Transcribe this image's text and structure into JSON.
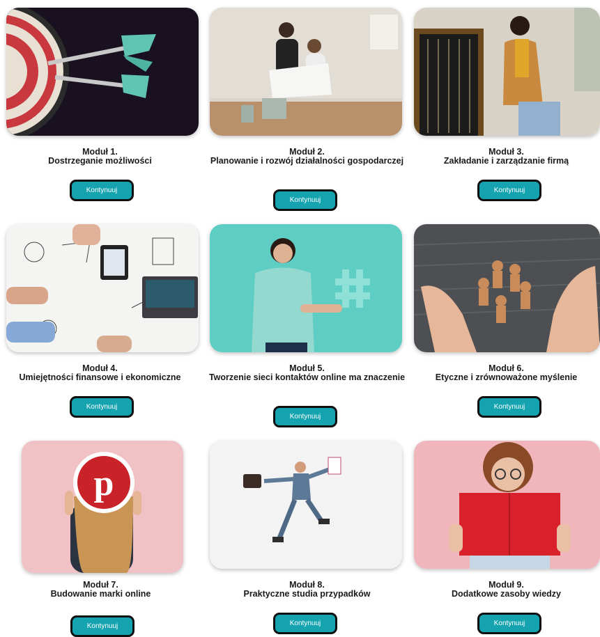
{
  "continue_label": "Kontynuuj",
  "accent": "#15a3b0",
  "modules": [
    {
      "number": "Moduł 1.",
      "title": "Dostrzeganie możliwości",
      "image": "darts-target-image"
    },
    {
      "number": "Moduł 2.",
      "title": "Planowanie i rozwój działalności gospodarczej",
      "image": "planning-people-image"
    },
    {
      "number": "Moduł 3.",
      "title": "Zakładanie i zarządzanie firmą",
      "image": "jewelry-shop-image"
    },
    {
      "number": "Moduł 4.",
      "title": "Umiejętności finansowe i ekonomiczne",
      "image": "finance-desk-image"
    },
    {
      "number": "Moduł 5.",
      "title": "Tworzenie sieci kontaktów online ma znaczenie",
      "image": "hashtag-woman-image"
    },
    {
      "number": "Moduł 6.",
      "title": "Etyczne i zrównoważone myślenie",
      "image": "hands-figures-image"
    },
    {
      "number": "Moduł 7.",
      "title": "Budowanie marki online",
      "image": "pinterest-logo-image"
    },
    {
      "number": "Moduł 8.",
      "title": "Praktyczne studia przypadków",
      "image": "running-businessman-image"
    },
    {
      "number": "Moduł 9.",
      "title": "Dodatkowe zasoby wiedzy",
      "image": "woman-red-book-image"
    }
  ]
}
